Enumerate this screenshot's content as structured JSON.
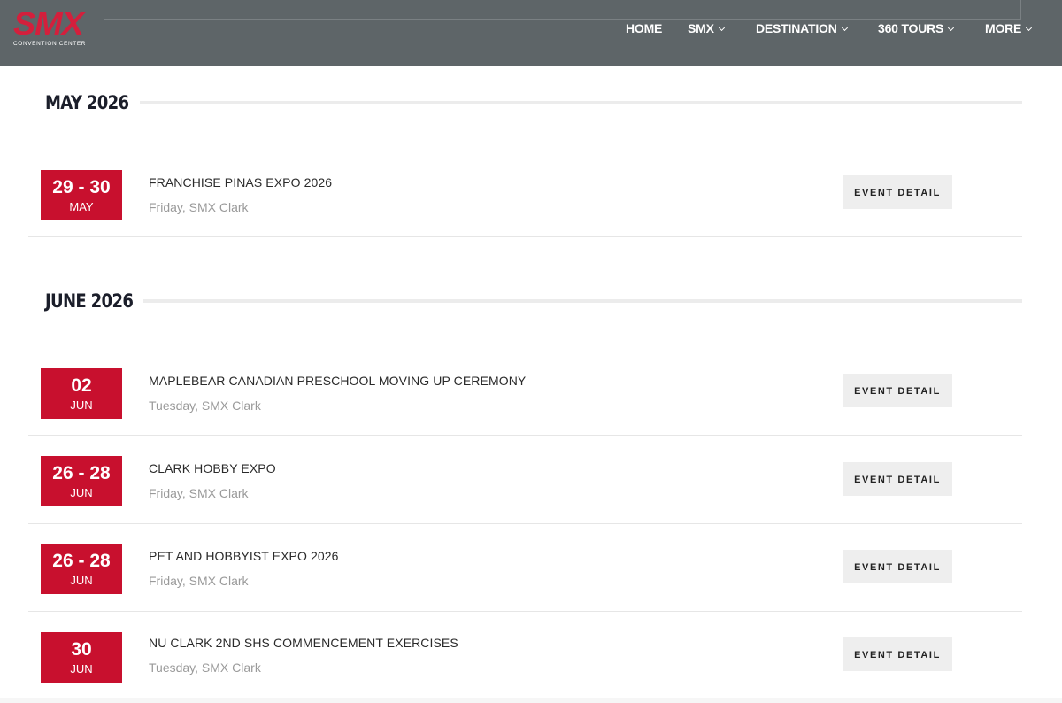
{
  "header": {
    "logo_text": "SMX",
    "logo_subtext": "CONVENTION CENTER",
    "nav": [
      {
        "label": "HOME",
        "has_dropdown": false
      },
      {
        "label": "SMX",
        "has_dropdown": true
      },
      {
        "label": "DESTINATION",
        "has_dropdown": true
      },
      {
        "label": "360 TOURS",
        "has_dropdown": true
      },
      {
        "label": "MORE",
        "has_dropdown": true
      }
    ]
  },
  "months": [
    {
      "heading": "MAY 2026",
      "events": [
        {
          "days": "29 - 30",
          "month": "MAY",
          "title": "FRANCHISE PINAS EXPO 2026",
          "subtitle": "Friday, SMX Clark",
          "button": "EVENT DETAIL"
        }
      ]
    },
    {
      "heading": "JUNE 2026",
      "events": [
        {
          "days": "02",
          "month": "JUN",
          "title": "MAPLEBEAR CANADIAN PRESCHOOL MOVING UP CEREMONY",
          "subtitle": "Tuesday, SMX Clark",
          "button": "EVENT DETAIL"
        },
        {
          "days": "26 - 28",
          "month": "JUN",
          "title": "CLARK HOBBY EXPO",
          "subtitle": "Friday, SMX Clark",
          "button": "EVENT DETAIL"
        },
        {
          "days": "26 - 28",
          "month": "JUN",
          "title": "PET AND HOBBYIST EXPO 2026",
          "subtitle": "Friday, SMX Clark",
          "button": "EVENT DETAIL"
        },
        {
          "days": "30",
          "month": "JUN",
          "title": "NU CLARK 2ND SHS COMMENCEMENT EXERCISES",
          "subtitle": "Tuesday, SMX Clark",
          "button": "EVENT DETAIL"
        }
      ]
    }
  ],
  "colors": {
    "header_bg": "#5e6568",
    "accent_red": "#c8102e",
    "button_bg": "#eeeeee"
  }
}
